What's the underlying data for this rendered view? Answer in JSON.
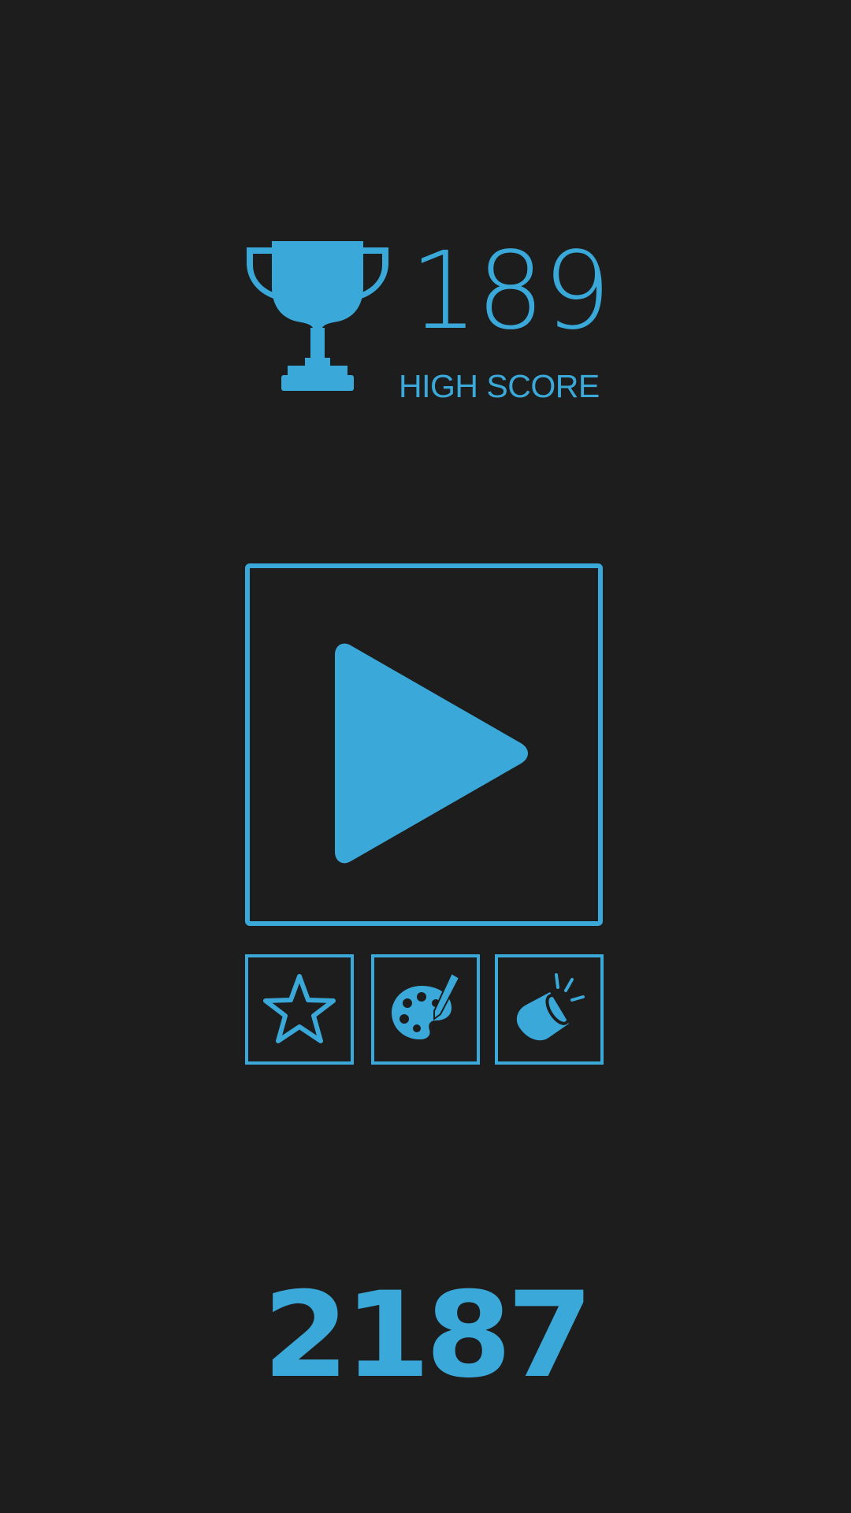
{
  "theme": {
    "background": "#1d1d1d",
    "accent": "#3aa9d9"
  },
  "high_score": {
    "value": "189",
    "label": "HIGH SCORE",
    "icon": "trophy-icon"
  },
  "buttons": {
    "play": {
      "icon": "play-icon"
    },
    "rate": {
      "icon": "star-icon"
    },
    "theme": {
      "icon": "palette-icon"
    },
    "sound": {
      "icon": "speaker-icon"
    }
  },
  "current_score": "2187"
}
